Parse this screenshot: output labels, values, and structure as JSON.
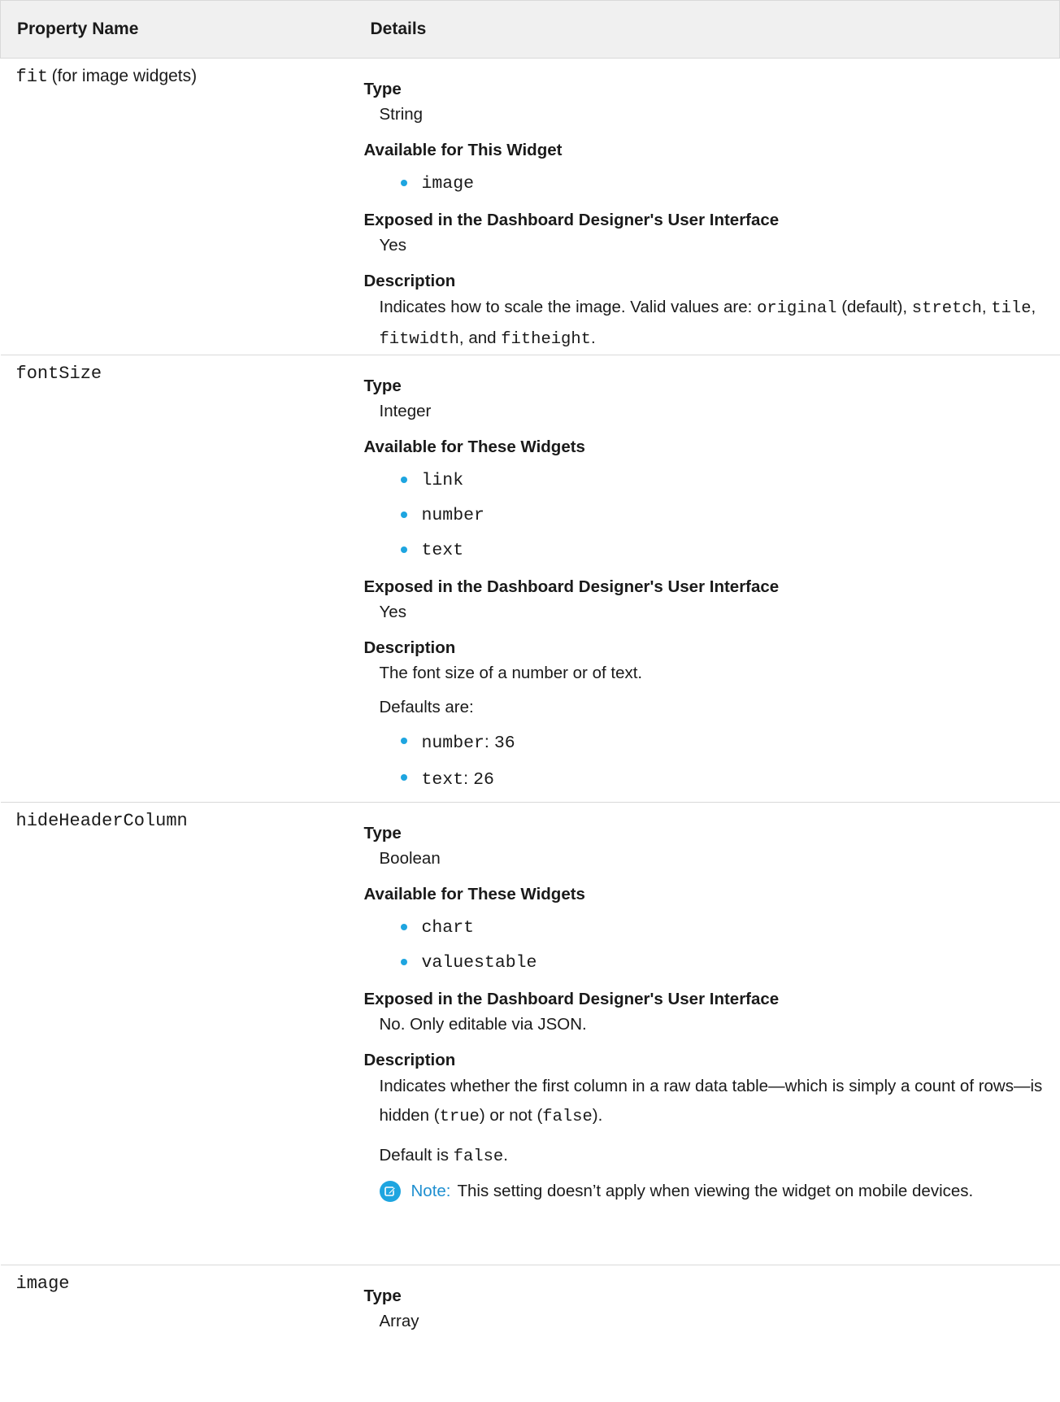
{
  "header": {
    "col1": "Property Name",
    "col2": "Details"
  },
  "labels": {
    "type": "Type",
    "available_this": "Available for This Widget",
    "available_these": "Available for These Widgets",
    "exposed": "Exposed in the Dashboard Designer's User Interface",
    "description": "Description"
  },
  "rows": {
    "fit": {
      "name_code": "fit",
      "name_suffix": "(for image widgets)",
      "type": "String",
      "widgets": [
        "image"
      ],
      "exposed": "Yes",
      "desc": {
        "t1": "Indicates how to scale the image. Valid values are:",
        "c1": "original",
        "t2": "(default),",
        "c2": "stretch",
        "t3": ",",
        "c3": "tile",
        "t4": ",",
        "c4": "fitwidth",
        "t5": ", and",
        "c5": "fitheight",
        "t6": "."
      }
    },
    "fontSize": {
      "name_code": "fontSize",
      "type": "Integer",
      "widgets": [
        "link",
        "number",
        "text"
      ],
      "exposed": "Yes",
      "desc": "The font size of a number or of text.",
      "defaults_intro": "Defaults are:",
      "defaults": [
        {
          "key": "number",
          "val": "36"
        },
        {
          "key": "text",
          "val": "26"
        }
      ]
    },
    "hideHeaderColumn": {
      "name_code": "hideHeaderColumn",
      "type": "Boolean",
      "widgets": [
        "chart",
        "valuestable"
      ],
      "exposed": "No. Only editable via JSON.",
      "desc": {
        "t1": "Indicates whether the first column in a raw data table—which is simply a count of rows—is hidden (",
        "c1": "true",
        "t2": ") or not (",
        "c2": "false",
        "t3": ")."
      },
      "default_prefix": "Default is",
      "default_value": "false",
      "default_suffix": ".",
      "note_label": "Note:",
      "note_text": "This setting doesn’t apply when viewing the widget on mobile devices."
    },
    "image": {
      "name_code": "image",
      "type": "Array"
    }
  },
  "icons": {
    "note": "edit-note-icon"
  },
  "colors": {
    "accent": "#1ea5e0",
    "note_label": "#1e8fd0",
    "header_bg": "#f0f0f0"
  }
}
